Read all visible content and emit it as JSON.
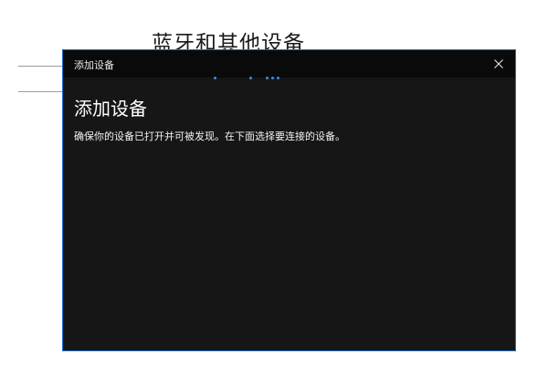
{
  "background_window": {
    "title": "蓝牙和其他设备"
  },
  "dialog": {
    "window_title": "添加设备",
    "close_icon": "close-icon",
    "heading": "添加设备",
    "description": "确保你的设备已打开并可被发现。在下面选择要连接的设备。",
    "progress_indicator": "searching",
    "accent_color": "#1f6fd1",
    "background_color": "#161616"
  }
}
